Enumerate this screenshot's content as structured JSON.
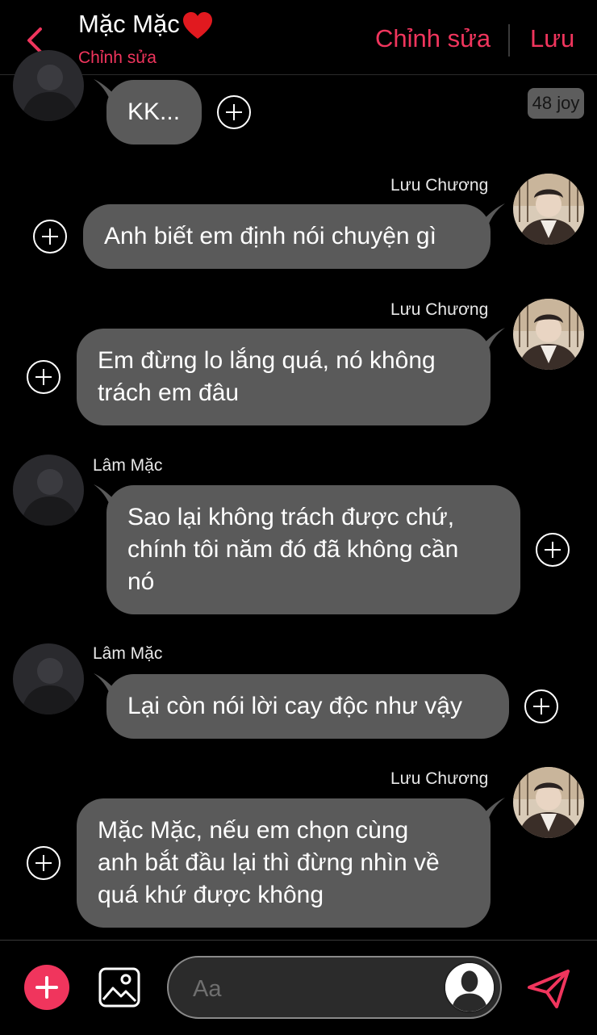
{
  "header": {
    "title": "Mặc Mặc",
    "subtitle": "Chỉnh sửa",
    "edit_label": "Chỉnh sửa",
    "save_label": "Lưu",
    "accent": "#f0355d"
  },
  "badge": "48 joy",
  "messages": [
    {
      "sender": "",
      "text": "KK..."
    },
    {
      "sender": "Lưu Chương",
      "text": "Anh biết em định nói chuyện gì"
    },
    {
      "sender": "Lưu Chương",
      "text": "Em đừng lo lắng quá, nó không\ntrách em đâu"
    },
    {
      "sender": "Lâm Mặc",
      "text": "Sao lại không trách được chứ,\nchính tôi năm đó đã không cần\nnó"
    },
    {
      "sender": "Lâm Mặc",
      "text": "Lại còn nói lời cay độc như vậy"
    },
    {
      "sender": "Lưu Chương",
      "text": "Mặc Mặc, nếu em chọn cùng\nanh bắt đầu lại thì đừng nhìn về\nquá khứ được không"
    }
  ],
  "composer": {
    "placeholder": "Aa"
  },
  "icons": {
    "back": "chevron-left-icon",
    "heart": "heart-icon",
    "add": "plus-icon",
    "image": "image-icon",
    "send": "send-icon"
  }
}
